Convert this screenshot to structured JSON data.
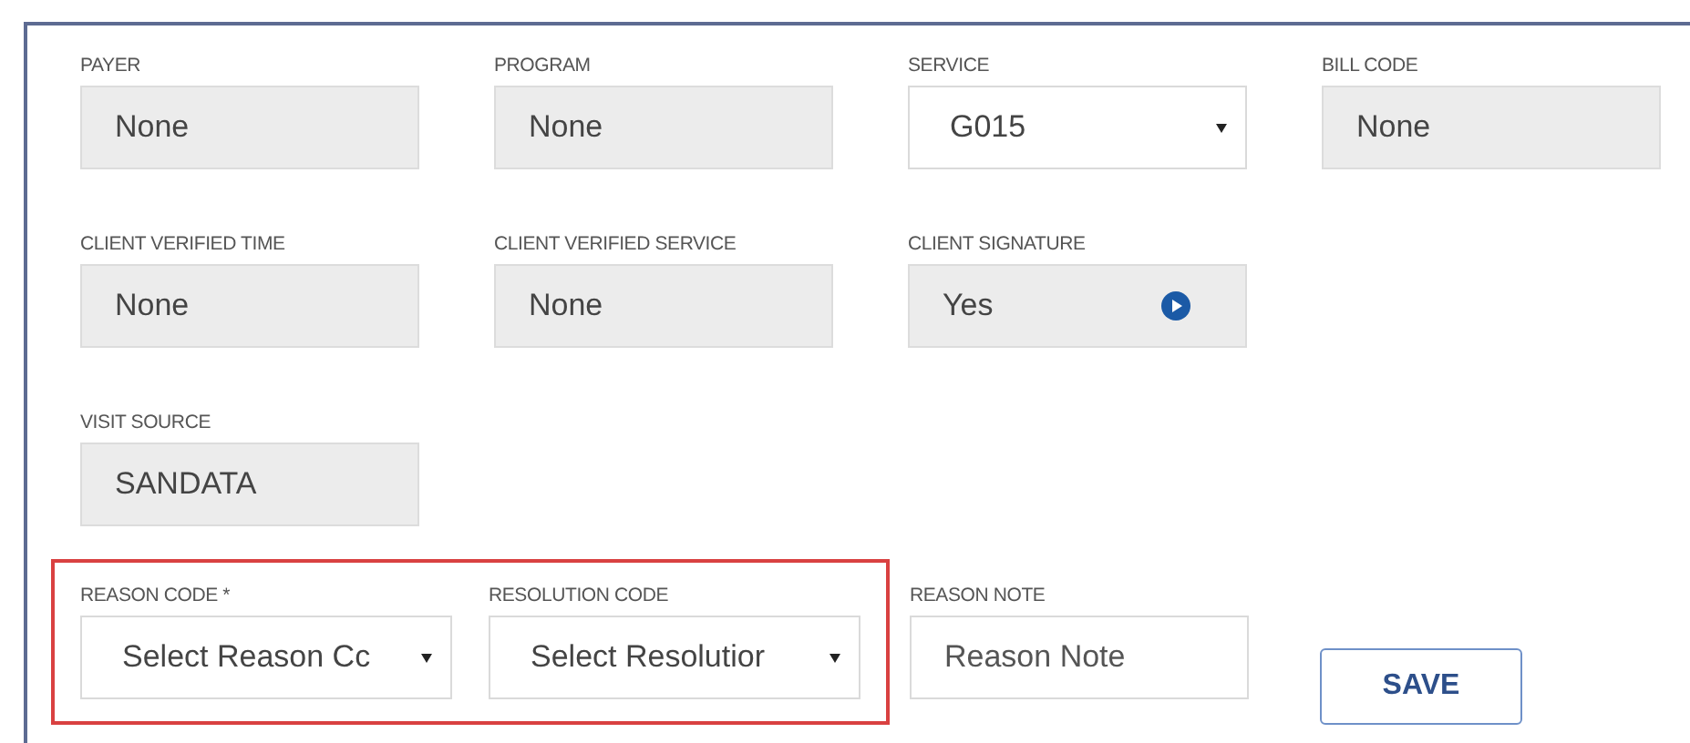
{
  "rows": [
    {
      "fields": [
        {
          "label": "PAYER",
          "kind": "readonly",
          "value": "None"
        },
        {
          "label": "PROGRAM",
          "kind": "readonly",
          "value": "None"
        },
        {
          "label": "SERVICE",
          "kind": "select",
          "value": "G015"
        },
        {
          "label": "BILL CODE",
          "kind": "readonly",
          "value": "None"
        }
      ]
    },
    {
      "fields": [
        {
          "label": "CLIENT VERIFIED TIME",
          "kind": "readonly",
          "value": "None"
        },
        {
          "label": "CLIENT VERIFIED SERVICE",
          "kind": "readonly",
          "value": "None"
        },
        {
          "label": "CLIENT SIGNATURE",
          "kind": "readonly_action",
          "value": "Yes"
        }
      ]
    },
    {
      "fields": [
        {
          "label": "VISIT SOURCE",
          "kind": "readonly",
          "value": "SANDATA"
        }
      ]
    }
  ],
  "action_row": {
    "highlighted_fields": [
      {
        "label": "REASON CODE *",
        "kind": "select",
        "value": "Select Reason Cc"
      },
      {
        "label": "RESOLUTION CODE",
        "kind": "select",
        "value": "Select Resolutior"
      }
    ],
    "fields": [
      {
        "label": "REASON NOTE",
        "kind": "text",
        "placeholder": "Reason Note"
      }
    ],
    "save_button": "SAVE"
  }
}
